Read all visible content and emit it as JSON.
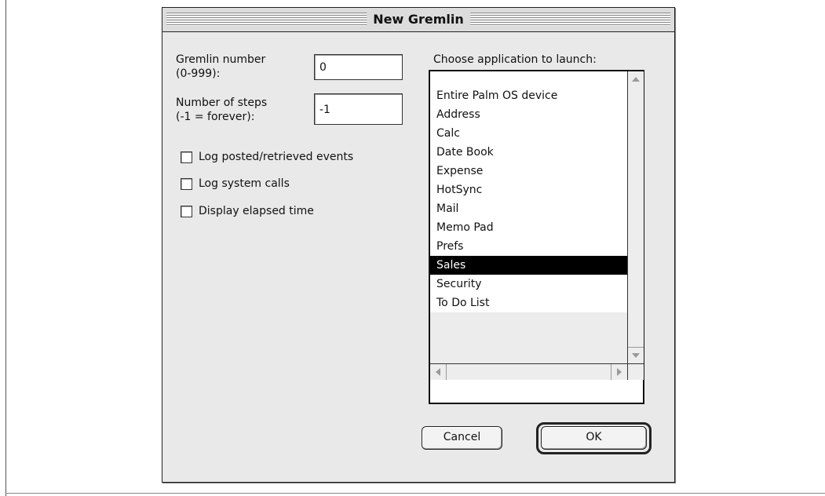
{
  "window": {
    "title": "New Gremlin"
  },
  "form": {
    "gremlin_number_label": "Gremlin number\n(0-999):",
    "gremlin_number_value": "0",
    "steps_label": "Number of steps\n(-1 = forever):",
    "steps_value": "-1"
  },
  "options": [
    {
      "label": "Log posted/retrieved events",
      "checked": false
    },
    {
      "label": "Log system calls",
      "checked": false
    },
    {
      "label": "Display elapsed time",
      "checked": false
    }
  ],
  "app_list": {
    "label": "Choose application to launch:",
    "items": [
      "Entire Palm OS device",
      "Address",
      "Calc",
      "Date Book",
      "Expense",
      "HotSync",
      "Mail",
      "Memo Pad",
      "Prefs",
      "Sales",
      "Security",
      "To Do List"
    ],
    "selected": "Sales"
  },
  "buttons": {
    "cancel": "Cancel",
    "ok": "OK"
  },
  "icons": {
    "scroll_up": "up-arrow-icon",
    "scroll_down": "down-arrow-icon",
    "scroll_left": "left-arrow-icon",
    "scroll_right": "right-arrow-icon"
  },
  "colors": {
    "selection": "#000000",
    "window_bg": "#e9e9e9"
  }
}
